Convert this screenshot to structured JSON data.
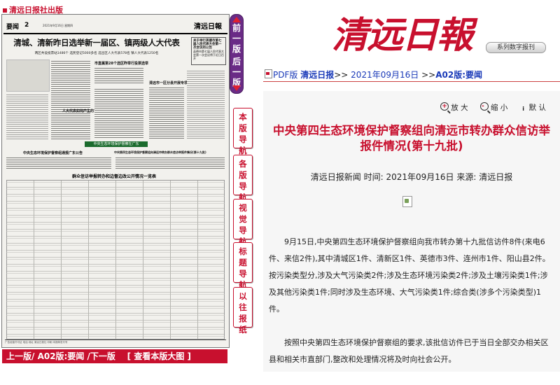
{
  "brand_bar": {
    "label": "清远日报社出版"
  },
  "newspaper_page": {
    "section": "要闻",
    "page_no": "2",
    "issue_date": "2021年9月16日 星期四",
    "masthead": "清远日報",
    "headline": "清城、清新昨日选举新一届区、镇两级人大代表",
    "subline": "两区共设投票站1486个 选民登记5000多名 选出区人大代表578名 镇人大代表1250名",
    "sidebox_title": "关于举行英德市第七届人民代表大会第一次会议的公告",
    "sidebox_body": "英德市第七届人民代表大会第一次会议将于近日召开",
    "mini_headings": [
      "市直属第28个选区昨举行投票选举",
      "人大代表如何产生的?",
      "清远市一区分县开展专项行动",
      "中央生态环境保护督察组通报广东公告",
      "中央第四生态环境保护督察组向清远市转办群众信访举报件情况(第十九批)"
    ],
    "banner": "中央生态环境保护督察在广东",
    "table_title": "群众信访举报转办和边督边改公开情况一览表",
    "footer": "广告经营许可证 电话 地址 清远日报社 印刷 本报邮发代号"
  },
  "bottom_nav": {
    "prev": "上一版/",
    "current": " A02版:要闻 ",
    "next": "/下一版",
    "view_large": "[ 查看本版大图 ]"
  },
  "pager": {
    "prev": "前一版",
    "next": "后一版"
  },
  "side_nav": [
    {
      "label": "本版导航"
    },
    {
      "label": "各版导航"
    },
    {
      "label": "视觉导航"
    },
    {
      "label": "标题导航"
    },
    {
      "label": "以往报纸"
    }
  ],
  "logo": {
    "text": "清远日報",
    "badge": "系列数字报刊"
  },
  "breadcrumb": {
    "pdf_label": "PDF版",
    "paper": "清远日报",
    "sep": ">>",
    "date": "2021年09月16日",
    "sep2": ">>",
    "page": "A02版:要闻"
  },
  "tools": {
    "zoom_in": "放 大",
    "zoom_out": "缩 小",
    "default": "默 认"
  },
  "article": {
    "title": "中央第四生态环境保护督察组向清远市转办群众信访举报件情况(第十九批)",
    "meta": "清远日报新闻 时间: 2021年09月16日 来源: 清远日报",
    "para1": "9月15日,中央第四生态环境保护督察组向我市转办第十九批信访件8件(来电6件、来信2件),其中清城区1件、清新区1件、英德市3件、连州市1件、阳山县2件。按污染类型分,涉及大气污染类2件;涉及生态环境污染类2件;涉及土壤污染类1件;涉及其他污染类1件;同时涉及生态环境、大气污染类1件;综合类(涉多个污染类型)1件。",
    "para2": "按照中央第四生态环境保护督察组的要求,该批信访件已于当日全部交办相关区县和相关市直部门,整改和处理情况将及时向社会公开。"
  },
  "colors": {
    "brand_red": "#c8102e",
    "pager_purple": "#6a2b86",
    "link_blue": "#1a3ab8"
  }
}
